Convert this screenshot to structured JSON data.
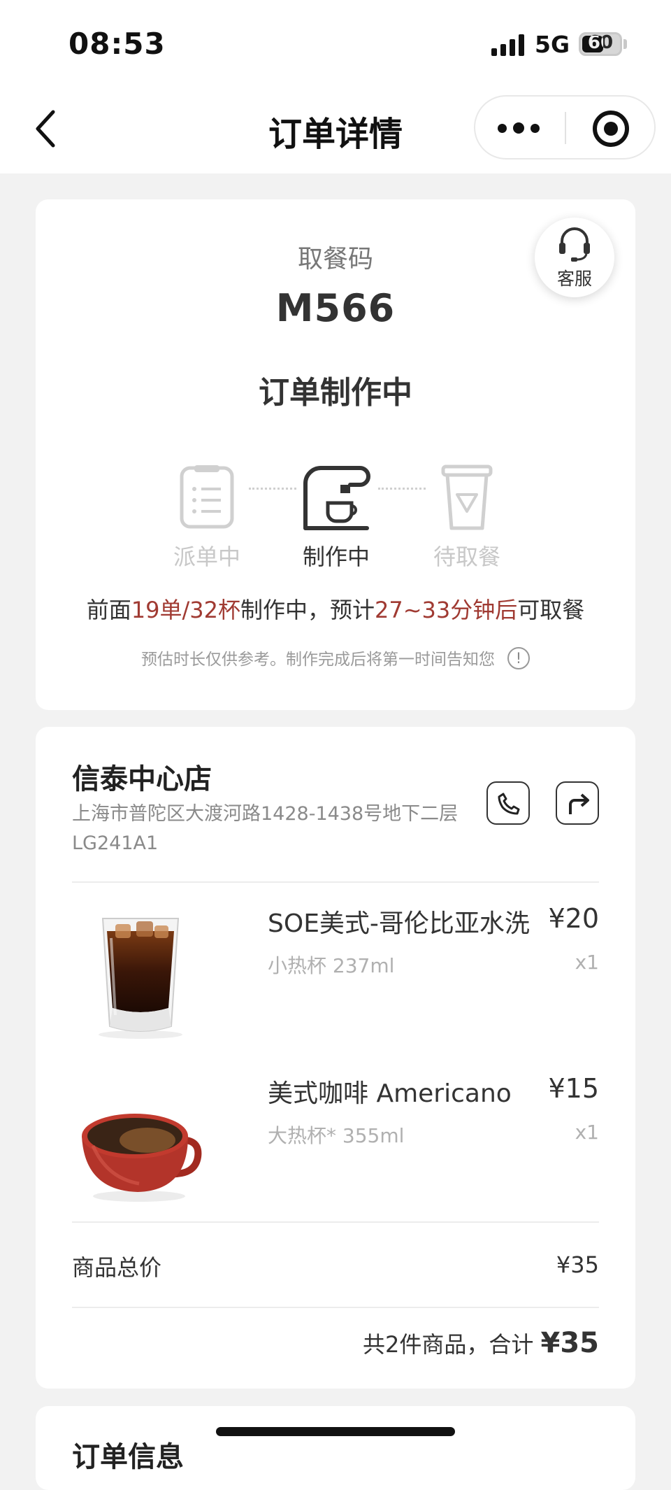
{
  "status_bar": {
    "time": "08:53",
    "network": "5G",
    "battery": "60",
    "battery_level": 0.6
  },
  "nav": {
    "title": "订单详情",
    "more_icon": "more-dots-icon",
    "target_icon": "target-icon",
    "back_icon": "chevron-left-icon"
  },
  "order": {
    "service_label": "客服",
    "pickup_label": "取餐码",
    "pickup_code": "M566",
    "status": "订单制作中",
    "steps": [
      {
        "label": "派单中",
        "icon": "order-list-icon",
        "active": false
      },
      {
        "label": "制作中",
        "icon": "coffee-machine-icon",
        "active": true
      },
      {
        "label": "待取餐",
        "icon": "cup-icon",
        "active": false
      }
    ],
    "queue": {
      "prefix": "前面",
      "count": "19单/32杯",
      "mid": "制作中，预计",
      "eta": "27~33分钟后",
      "suffix": "可取餐"
    },
    "hint": "预估时长仅供参考。制作完成后将第一时间告知您"
  },
  "store": {
    "name": "信泰中心店",
    "address": "上海市普陀区大渡河路1428-1438号地下二层LG241A1"
  },
  "items": [
    {
      "name": "SOE美式-哥伦比亚水洗",
      "spec": "小热杯 237ml",
      "price": "¥20",
      "qty": "x1",
      "image": "iced-coffee-glass"
    },
    {
      "name": "美式咖啡 Americano",
      "spec": "大热杯* 355ml",
      "price": "¥15",
      "qty": "x1",
      "image": "red-coffee-cup"
    }
  ],
  "totals": {
    "subtotal_label": "商品总价",
    "subtotal_value": "¥35",
    "summary_prefix": "共2件商品，合计",
    "summary_total": "¥35"
  },
  "order_info": {
    "title": "订单信息"
  },
  "colors": {
    "highlight": "#a03a32",
    "background": "#f2f2f2"
  }
}
